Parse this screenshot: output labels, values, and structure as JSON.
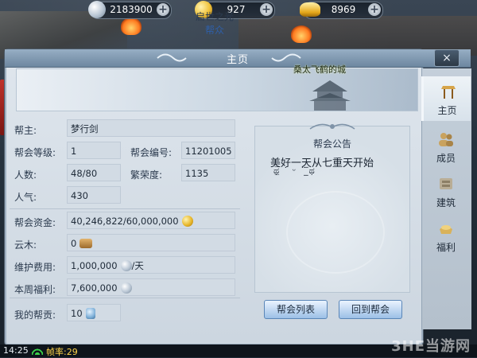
{
  "currencies": [
    {
      "icon": "silver-coin-icon",
      "value": "2183900",
      "plus": "+"
    },
    {
      "icon": "gold-coin-icon",
      "value": "927",
      "plus": "+"
    },
    {
      "icon": "gold-ingot-icon",
      "value": "8969",
      "plus": "+"
    }
  ],
  "window": {
    "title": "主页",
    "close": "×"
  },
  "banner": {
    "guild_name": "启世之光",
    "role": "帮众",
    "tag": "桑太飞鹤的城"
  },
  "info": {
    "leader": {
      "label": "帮主:",
      "value": "梦行剑"
    },
    "level": {
      "label": "帮会等级:",
      "value": "1"
    },
    "guild_id": {
      "label": "帮会编号:",
      "value": "11201005"
    },
    "members": {
      "label": "人数:",
      "value": "48/80"
    },
    "prosperity": {
      "label": "繁荣度:",
      "value": "1135"
    },
    "popularity": {
      "label": "人气:",
      "value": "430"
    },
    "funds": {
      "label": "帮会资金:",
      "value": "40,246,822/60,000,000",
      "icon": "gold-coin-icon"
    },
    "wood": {
      "label": "云木:",
      "value": "0",
      "icon": "wood-icon"
    },
    "upkeep": {
      "label": "维护费用:",
      "value": "1,000,000",
      "suffix": "/天",
      "icon": "silver-coin-icon"
    },
    "weekly_welfare": {
      "label": "本周福利:",
      "value": "7,600,000",
      "icon": "silver-coin-icon"
    },
    "my_contribution": {
      "label": "我的帮贡:",
      "value": "10",
      "icon": "contribution-icon"
    }
  },
  "notice": {
    "title": "帮会公告",
    "body": "美好一天从七重天开始",
    "emoticon": "ಥ̲̅ ˙ ᵕ ˙ ̲̅ಥ"
  },
  "buttons": {
    "guild_list": "帮会列表",
    "return_guild": "回到帮会"
  },
  "tabs": [
    {
      "label": "主页",
      "icon": "home-icon",
      "active": true
    },
    {
      "label": "成员",
      "icon": "members-icon",
      "active": false
    },
    {
      "label": "建筑",
      "icon": "building-icon",
      "active": false
    },
    {
      "label": "福利",
      "icon": "welfare-icon",
      "active": false
    }
  ],
  "status_bar": {
    "time": "14:25",
    "fps": "帧率:29",
    "watermark": "3HE当游网"
  }
}
